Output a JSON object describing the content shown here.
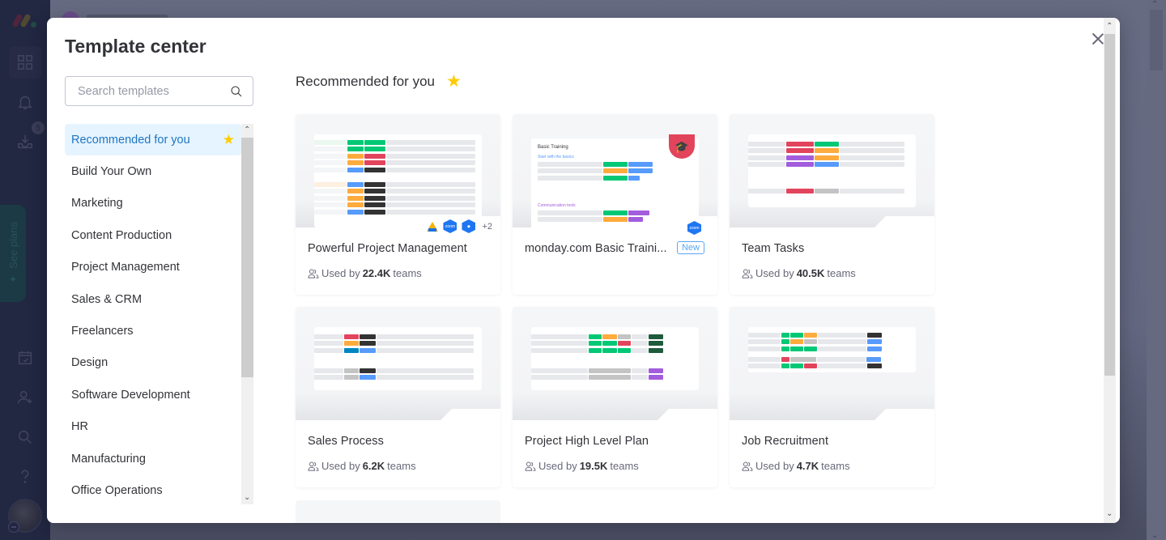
{
  "app": {
    "rail": {
      "icons": [
        "monday-logo",
        "workspace-grid-icon",
        "bell-icon",
        "inbox-download-icon",
        "calendar-check-icon",
        "invite-user-icon",
        "search-icon",
        "help-icon"
      ],
      "inbox_badge": "5",
      "see_plans_label": "See plans"
    }
  },
  "modal": {
    "title": "Template center",
    "search": {
      "placeholder": "Search templates",
      "value": ""
    },
    "categories": [
      {
        "label": "Recommended for you",
        "active": true,
        "icon": "star-icon"
      },
      {
        "label": "Build Your Own"
      },
      {
        "label": "Marketing"
      },
      {
        "label": "Content Production"
      },
      {
        "label": "Project Management"
      },
      {
        "label": "Sales & CRM"
      },
      {
        "label": "Freelancers"
      },
      {
        "label": "Design"
      },
      {
        "label": "Software Development"
      },
      {
        "label": "HR"
      },
      {
        "label": "Manufacturing"
      },
      {
        "label": "Office Operations"
      }
    ],
    "section_title": "Recommended for you",
    "used_prefix": "Used by",
    "used_suffix": "teams",
    "templates": [
      {
        "name": "Powerful Project Management",
        "used_count": "22.4K",
        "integrations": [
          "google-drive",
          "zoom",
          "dropbox"
        ],
        "more_integrations": "+2"
      },
      {
        "name": "monday.com Basic Traini...",
        "badge": "New",
        "integrations": [
          "zoom"
        ],
        "preview_title": "Basic Training",
        "preview_groups": [
          "Start with the basics",
          "Communication tools"
        ]
      },
      {
        "name": "Team Tasks",
        "used_count": "40.5K"
      },
      {
        "name": "Sales Process",
        "used_count": "6.2K"
      },
      {
        "name": "Project High Level Plan",
        "used_count": "19.5K"
      },
      {
        "name": "Job Recruitment",
        "used_count": "4.7K"
      }
    ]
  },
  "colors": {
    "accent": "#1f76c2",
    "active_bg": "#e6f4ff",
    "star": "#ffcb00",
    "done_green": "#00c875",
    "working_orange": "#fdab3d",
    "stuck_red": "#e2445c",
    "purple": "#a25ddc",
    "blue": "#579bfc",
    "dark": "#333333"
  }
}
